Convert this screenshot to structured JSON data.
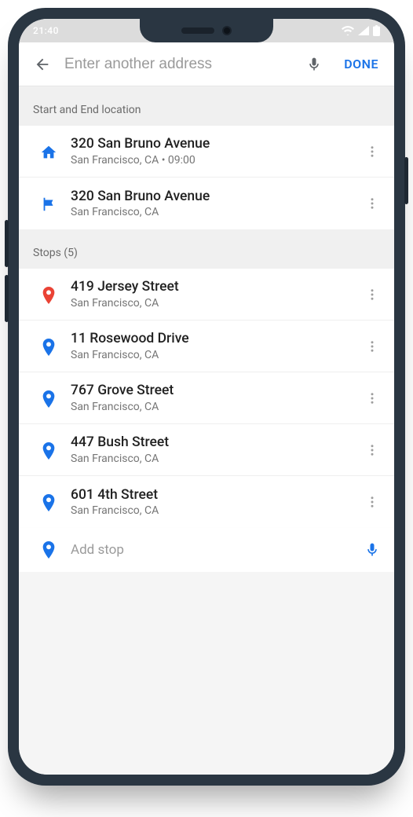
{
  "status": {
    "time": "21:40"
  },
  "search": {
    "placeholder": "Enter another address",
    "done_label": "DONE"
  },
  "sections": {
    "start_end_label": "Start and End location",
    "stops_label": "Stops (5)"
  },
  "start_end": [
    {
      "icon": "home",
      "title": "320 San Bruno Avenue",
      "sub": "San Francisco, CA • 09:00"
    },
    {
      "icon": "flag",
      "title": "320 San Bruno Avenue",
      "sub": "San Francisco, CA"
    }
  ],
  "stops": [
    {
      "icon": "pin-red",
      "title": "419 Jersey Street",
      "sub": "San Francisco, CA"
    },
    {
      "icon": "pin-blue",
      "title": "11 Rosewood Drive",
      "sub": "San Francisco, CA"
    },
    {
      "icon": "pin-blue",
      "title": "767 Grove Street",
      "sub": "San Francisco, CA"
    },
    {
      "icon": "pin-blue",
      "title": "447 Bush Street",
      "sub": "San Francisco, CA"
    },
    {
      "icon": "pin-blue",
      "title": "601 4th Street",
      "sub": "San Francisco, CA"
    }
  ],
  "add_stop": {
    "placeholder": "Add stop"
  },
  "colors": {
    "blue": "#1a73e8",
    "red": "#ea4335",
    "grey": "#8a8a8a"
  }
}
